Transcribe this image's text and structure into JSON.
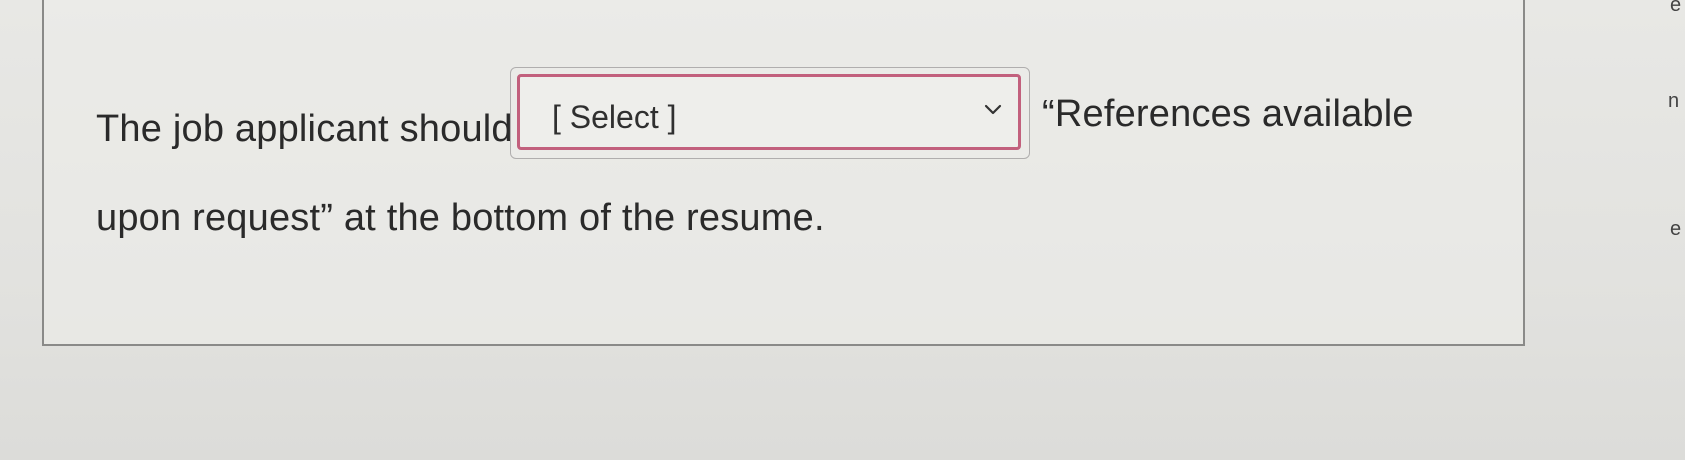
{
  "question": {
    "text_before": "The job applicant should",
    "dropdown": {
      "selected": "[ Select ]",
      "icon": "chevron-down-icon"
    },
    "text_after_line1": "“References available",
    "text_line2": "upon request” at the bottom of the resume."
  },
  "edge_fragments": {
    "top": "e",
    "middle": "n",
    "lower": "e"
  },
  "colors": {
    "dropdown_focus_border": "#c2607d",
    "text": "#2a2a2a"
  }
}
